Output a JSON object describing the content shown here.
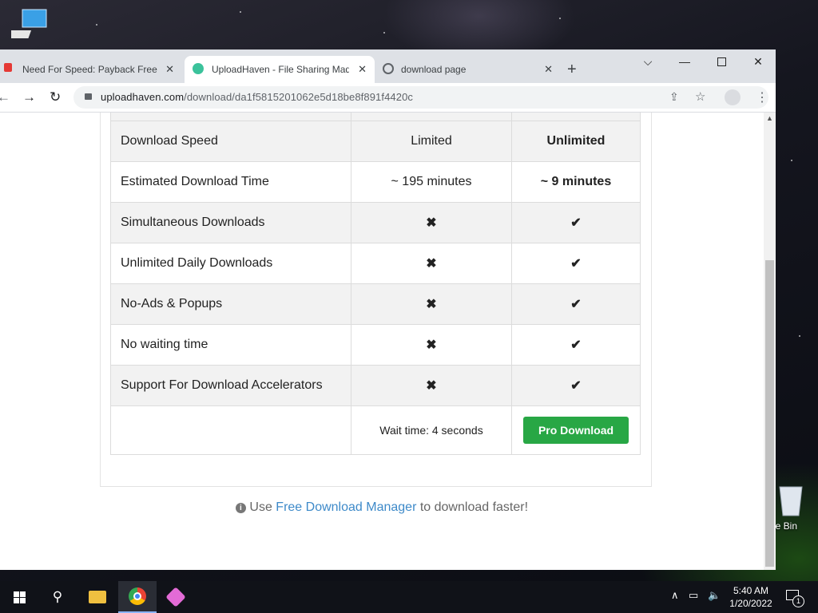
{
  "desktop": {
    "recycle_label": "cle Bin"
  },
  "browser": {
    "tabs": [
      {
        "label": "Need For Speed: Payback Free D",
        "active": false
      },
      {
        "label": "UploadHaven - File Sharing Mad",
        "active": true
      },
      {
        "label": "download page",
        "active": false
      }
    ],
    "url_host": "uploadhaven.com",
    "url_path": "/download/da1f5815201062e5d18be8f891f4420c"
  },
  "comparison": {
    "rows": [
      {
        "feature": "Download Speed",
        "free": "Limited",
        "pro": "Unlimited"
      },
      {
        "feature": "Estimated Download Time",
        "free": "~ 195 minutes",
        "pro": "~ 9 minutes"
      },
      {
        "feature": "Simultaneous Downloads",
        "free": "✖",
        "pro": "✔"
      },
      {
        "feature": "Unlimited Daily Downloads",
        "free": "✖",
        "pro": "✔"
      },
      {
        "feature": "No-Ads & Popups",
        "free": "✖",
        "pro": "✔"
      },
      {
        "feature": "No waiting time",
        "free": "✖",
        "pro": "✔"
      },
      {
        "feature": "Support For Download Accelerators",
        "free": "✖",
        "pro": "✔"
      }
    ],
    "wait_text": "Wait time: 4 seconds",
    "pro_button": "Pro Download"
  },
  "note": {
    "prefix": "Use",
    "link": "Free Download Manager",
    "suffix": "to download faster!"
  },
  "taskbar": {
    "time": "5:40 AM",
    "date": "1/20/2022",
    "notification_count": "1"
  },
  "colors": {
    "accent_green": "#28a745",
    "cross_red": "#d9394b",
    "link_blue": "#3e8ac9"
  }
}
